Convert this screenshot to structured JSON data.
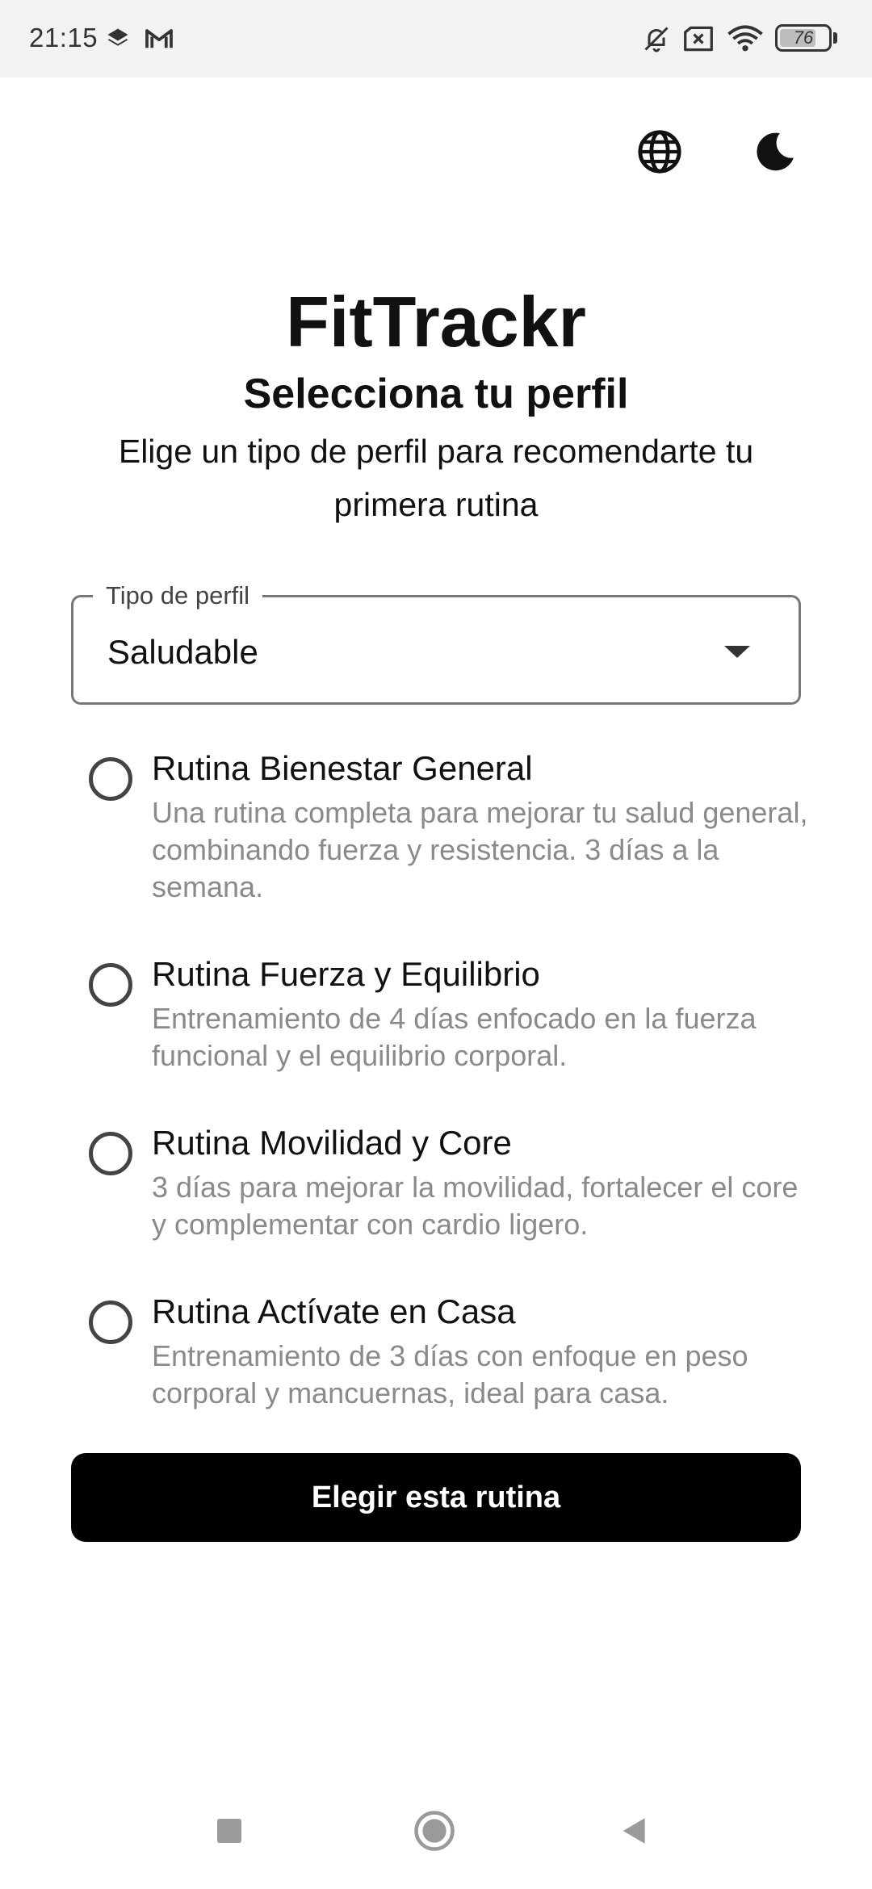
{
  "status_bar": {
    "time": "21:15",
    "battery_level": "76",
    "battery_fraction": 0.76,
    "icons": [
      "layers-icon",
      "gmail-icon",
      "bell-off-icon",
      "sim-error-icon",
      "wifi-icon",
      "battery-icon"
    ]
  },
  "top_actions": {
    "language_icon": "globe-icon",
    "theme_icon": "moon-icon"
  },
  "header": {
    "app_title": "FitTrackr",
    "subtitle": "Selecciona tu perfil",
    "description": "Elige un tipo de perfil para recomendarte tu primera rutina"
  },
  "profile_select": {
    "label": "Tipo de perfil",
    "value": "Saludable"
  },
  "routines": [
    {
      "title": "Rutina Bienestar General",
      "description": "Una rutina completa para mejorar tu salud general, combinando fuerza y resistencia. 3 días a la semana.",
      "selected": false
    },
    {
      "title": "Rutina Fuerza y Equilibrio",
      "description": "Entrenamiento de 4 días enfocado en la fuerza funcional y el equilibrio corporal.",
      "selected": false
    },
    {
      "title": "Rutina Movilidad y Core",
      "description": "3 días para mejorar la movilidad, fortalecer el core y complementar con cardio ligero.",
      "selected": false
    },
    {
      "title": "Rutina Actívate en Casa",
      "description": "Entrenamiento de 3 días con enfoque en peso corporal y mancuernas, ideal para casa.",
      "selected": false
    }
  ],
  "primary_action": {
    "label": "Elegir esta rutina"
  },
  "colors": {
    "primary": "#000000",
    "background": "#ffffff",
    "status_bar_bg": "#f2f2f2",
    "secondary_text": "#8a8a8a"
  }
}
